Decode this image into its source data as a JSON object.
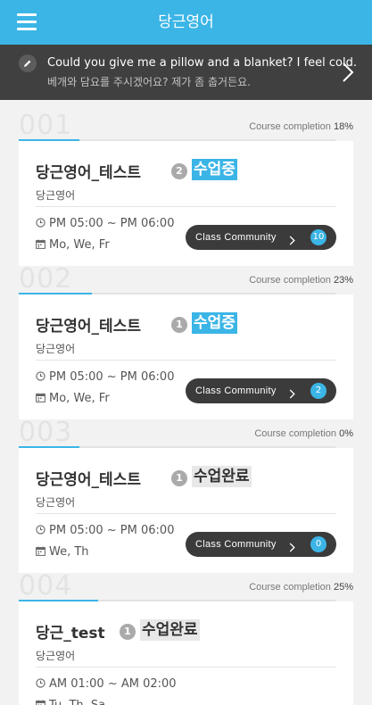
{
  "header": {
    "title": "당근영어"
  },
  "banner": {
    "english": "Could you give me a pillow and a blanket? I feel cold.",
    "korean": "베개와 담요를 주시겠어요? 제가 좀 춥거든요."
  },
  "completion_label": "Course completion",
  "community_label": "Class Community",
  "courses": [
    {
      "number": "001",
      "completion": "18%",
      "completion_value": 0.18,
      "title": "당근영어_테스트",
      "badge": "2",
      "status": "수업중",
      "status_type": "live",
      "subtitle": "당근영어",
      "time": "PM 05:00 ~ PM 06:00",
      "days": "Mo, We, Fr",
      "community_count": "10"
    },
    {
      "number": "002",
      "completion": "23%",
      "completion_value": 0.23,
      "title": "당근영어_테스트",
      "badge": "1",
      "status": "수업중",
      "status_type": "live",
      "subtitle": "당근영어",
      "time": "PM 05:00 ~ PM 06:00",
      "days": "Mo, We, Fr",
      "community_count": "2"
    },
    {
      "number": "003",
      "completion": "0%",
      "completion_value": 0.0,
      "title": "당근영어_테스트",
      "badge": "1",
      "status": "수업완료",
      "status_type": "done",
      "subtitle": "당근영어",
      "time": "PM 05:00 ~ PM 06:00",
      "days": "We, Th",
      "community_count": "0"
    },
    {
      "number": "004",
      "completion": "25%",
      "completion_value": 0.25,
      "title": "당근_test",
      "badge": "1",
      "status": "수업완료",
      "status_type": "done",
      "subtitle": "당근영어",
      "time": "AM 01:00 ~ AM 02:00",
      "days": "Tu, Th, Sa",
      "community_count": null
    }
  ],
  "icons": {
    "menu": "hamburger-menu-icon",
    "pencil": "pencil-icon",
    "next": "chevron-right-icon",
    "clock": "clock-icon",
    "calendar": "calendar-icon"
  },
  "colors": {
    "accent": "#3bb5e6",
    "banner_bg": "#404040",
    "button_bg": "#3b3b3b"
  }
}
